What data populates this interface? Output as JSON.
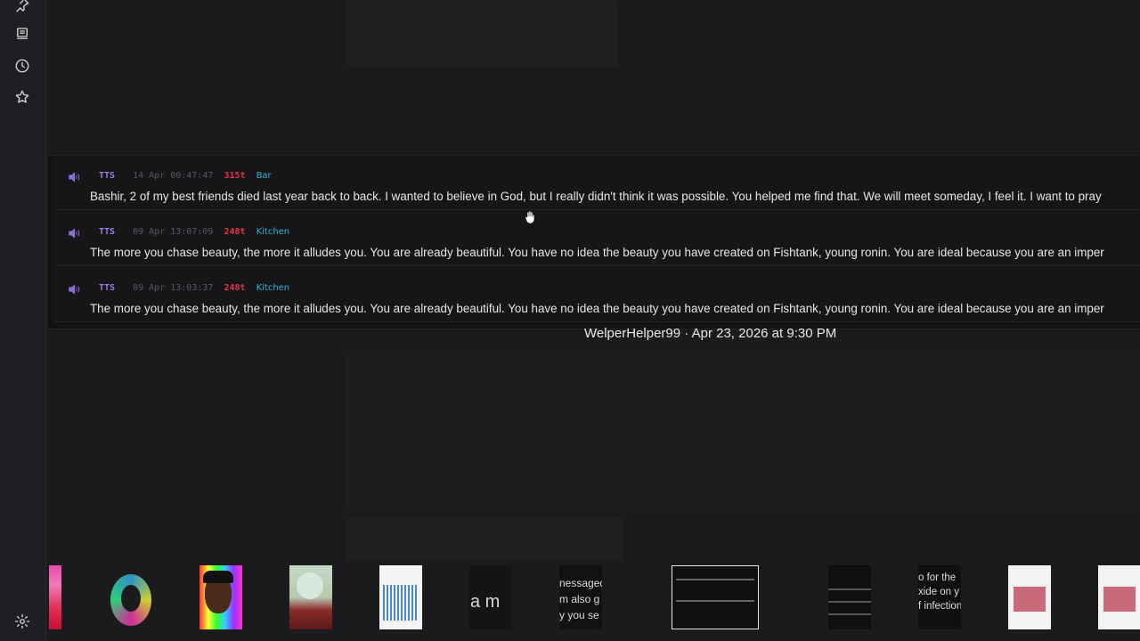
{
  "sidebar": {
    "icons": [
      "pin-icon",
      "bookmark-stack-icon",
      "clock-icon",
      "star-icon",
      "gear-icon"
    ]
  },
  "messages": [
    {
      "badge": "TTS",
      "time": "14 Apr 00:47:47",
      "tokens": "315t",
      "room": "Bar",
      "text": "Bashir, 2 of my best friends died last year back to back. I wanted to believe in God, but I really didn't think it was possible. You helped me find that. We will meet someday, I feel it. I want to pray"
    },
    {
      "badge": "TTS",
      "time": "09 Apr 13:07:09",
      "tokens": "248t",
      "room": "Kitchen",
      "text": "The more you chase beauty, the more it alludes you. You are already beautiful. You have no idea the beauty you have created on Fishtank, young ronin. You are ideal because you are an imper"
    },
    {
      "badge": "TTS",
      "time": "09 Apr 13:03:37",
      "tokens": "248t",
      "room": "Kitchen",
      "text": "The more you chase beauty, the more it alludes you. You are already beautiful. You have no idea the beauty you have created on Fishtank, young ronin. You are ideal because you are an imper"
    }
  ],
  "caption": "WelperHelper99 · Apr 23, 2026 at 9:30 PM",
  "thumbs": {
    "t6_text": "a m",
    "t7_lines": [
      "nessaged",
      "m also g",
      "y you se"
    ],
    "t11_lines": [
      "o for the",
      "xide on y",
      "f infection"
    ]
  },
  "colors": {
    "accent_purple": "#9b7be6",
    "tokens_red": "#e0354a",
    "room_cyan": "#2bb5d8"
  }
}
